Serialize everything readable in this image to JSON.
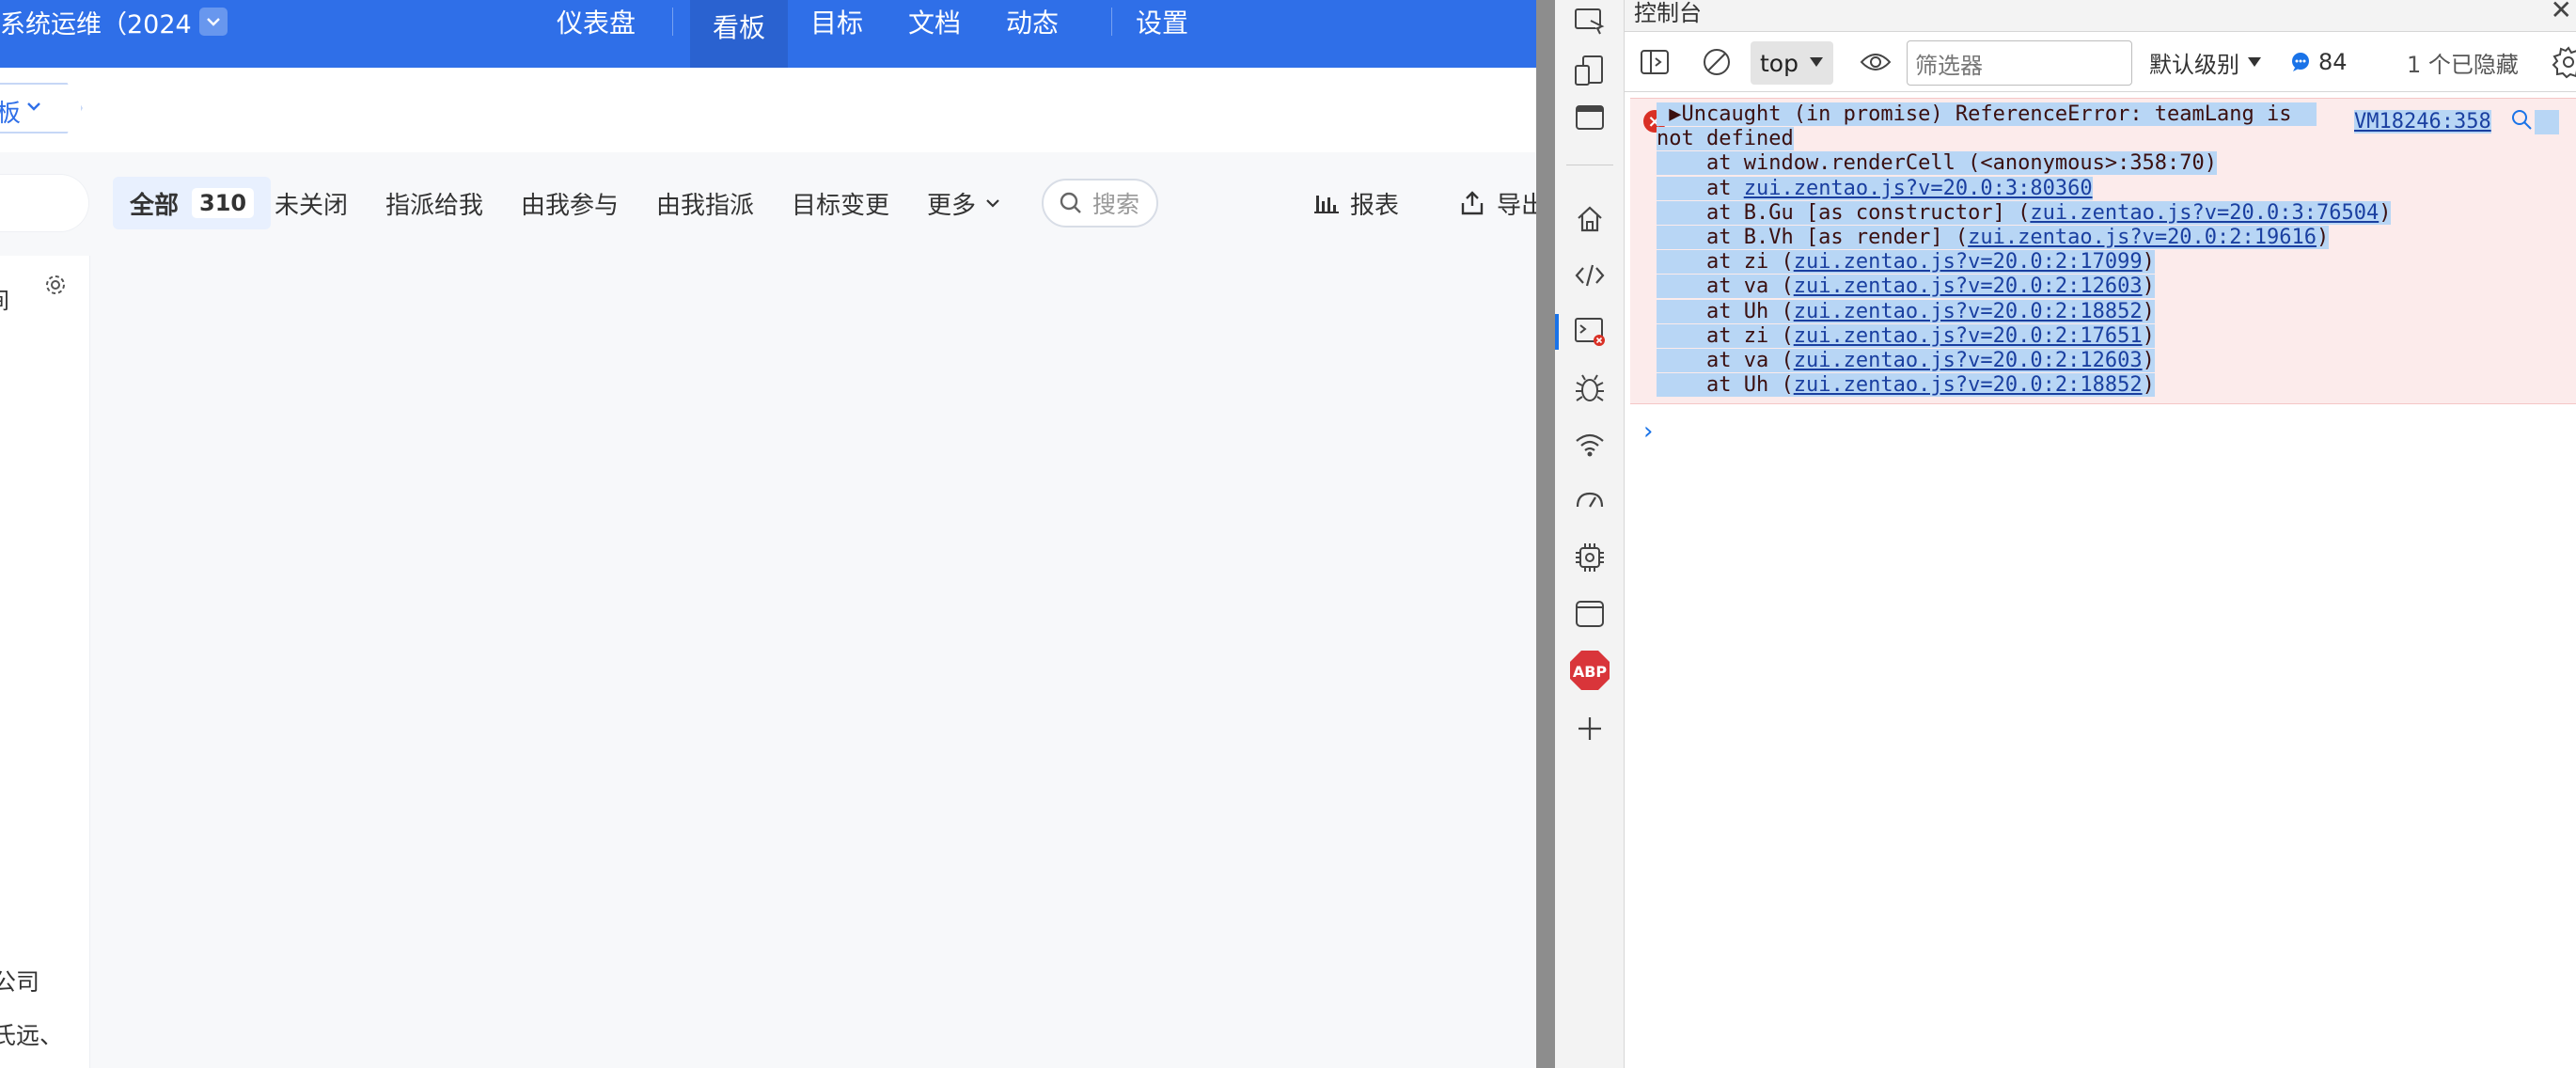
{
  "app": {
    "project_title": "系统运维（2024",
    "nav": [
      "仪表盘",
      "看板",
      "目标",
      "文档",
      "动态",
      "设置"
    ],
    "active_nav": "看板",
    "breadcrumb": "板",
    "tabs": [
      {
        "label": "全部",
        "count": "310"
      },
      {
        "label": "未关闭"
      },
      {
        "label": "指派给我"
      },
      {
        "label": "由我参与"
      },
      {
        "label": "由我指派"
      },
      {
        "label": "目标变更"
      },
      {
        "label": "更多"
      }
    ],
    "search_placeholder": "搜索",
    "report_label": "报表",
    "export_label": "导出",
    "side": {
      "t1": "间",
      "t2": "公司",
      "t3": "氏远、"
    }
  },
  "devtools": {
    "panel_title": "控制台",
    "context": "top",
    "filter_placeholder": "筛选器",
    "level": "默认级别",
    "message_count": "84",
    "hidden": "1 个已隐藏",
    "error": {
      "message_line1": "Uncaught (in promise) ReferenceError: teamLang is",
      "message_line2": "not defined",
      "source": "VM18246:358",
      "stack": [
        {
          "prefix": "    at window.renderCell (<anonymous>:358:70)",
          "link": ""
        },
        {
          "prefix": "    at ",
          "link": "zui.zentao.js?v=20.0:3:80360"
        },
        {
          "prefix": "    at B.Gu [as constructor] (",
          "link": "zui.zentao.js?v=20.0:3:76504",
          "suffix": ")"
        },
        {
          "prefix": "    at B.Vh [as render] (",
          "link": "zui.zentao.js?v=20.0:2:19616",
          "suffix": ")"
        },
        {
          "prefix": "    at zi (",
          "link": "zui.zentao.js?v=20.0:2:17099",
          "suffix": ")"
        },
        {
          "prefix": "    at va (",
          "link": "zui.zentao.js?v=20.0:2:12603",
          "suffix": ")"
        },
        {
          "prefix": "    at Uh (",
          "link": "zui.zentao.js?v=20.0:2:18852",
          "suffix": ")"
        },
        {
          "prefix": "    at zi (",
          "link": "zui.zentao.js?v=20.0:2:17651",
          "suffix": ")"
        },
        {
          "prefix": "    at va (",
          "link": "zui.zentao.js?v=20.0:2:12603",
          "suffix": ")"
        },
        {
          "prefix": "    at Uh (",
          "link": "zui.zentao.js?v=20.0:2:18852",
          "suffix": ")"
        }
      ]
    },
    "sidebar_icons": [
      "inspect-icon",
      "device-icon",
      "window-icon",
      "home-icon",
      "code-icon",
      "console-icon",
      "bug-icon",
      "network-icon",
      "performance-icon",
      "memory-icon",
      "application-icon",
      "adblock-icon",
      "add-icon"
    ],
    "adblock_label": "ABP"
  }
}
